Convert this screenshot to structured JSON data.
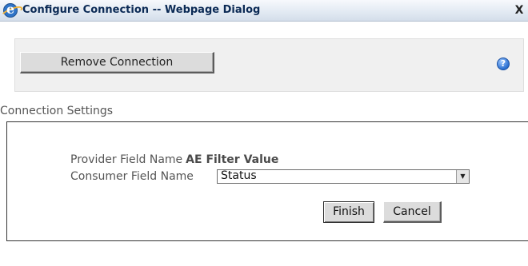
{
  "window": {
    "title": "Configure Connection -- Webpage Dialog",
    "close_glyph": "X",
    "browser_icon": "ie-icon"
  },
  "toolbar": {
    "remove_label": "Remove Connection",
    "help_glyph": "?"
  },
  "settings": {
    "section_label": "Connection Settings",
    "provider_label": "Provider Field Name",
    "provider_value": "AE Filter Value",
    "consumer_label": "Consumer Field Name",
    "consumer_selected": "Status",
    "finish_label": "Finish",
    "cancel_label": "Cancel"
  }
}
